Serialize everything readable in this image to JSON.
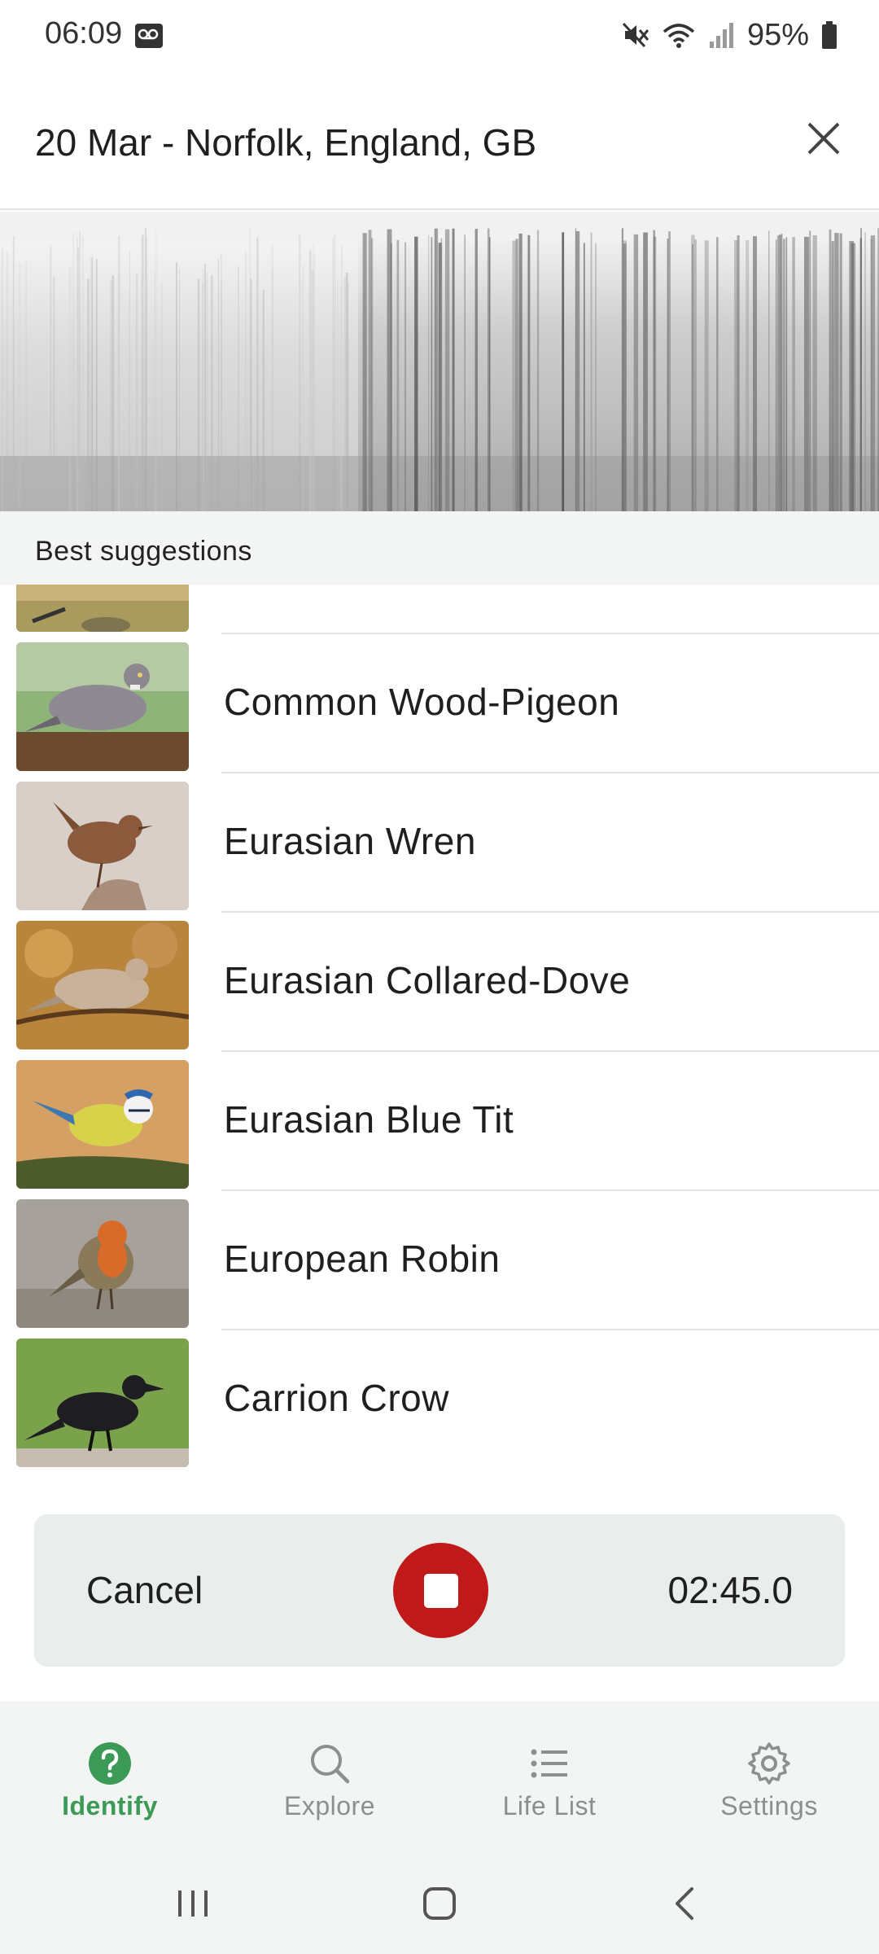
{
  "status_bar": {
    "time": "06:09",
    "battery": "95%"
  },
  "header": {
    "title": "20 Mar - Norfolk, England, GB",
    "close_icon": "close-icon"
  },
  "section": {
    "label": "Best suggestions"
  },
  "suggestions": [
    {
      "name": "",
      "image": "bird-thumbnail-partial"
    },
    {
      "name": "Common Wood-Pigeon",
      "image": "wood-pigeon-photo"
    },
    {
      "name": "Eurasian Wren",
      "image": "wren-photo"
    },
    {
      "name": "Eurasian Collared-Dove",
      "image": "collared-dove-photo"
    },
    {
      "name": "Eurasian Blue Tit",
      "image": "blue-tit-photo"
    },
    {
      "name": "European Robin",
      "image": "robin-photo"
    },
    {
      "name": "Carrion Crow",
      "image": "crow-photo"
    }
  ],
  "recording": {
    "cancel_label": "Cancel",
    "timer": "02:45.0",
    "stop_color": "#c0191a"
  },
  "nav": {
    "items": [
      {
        "label": "Identify",
        "icon": "help-circle-icon",
        "active": true
      },
      {
        "label": "Explore",
        "icon": "search-icon",
        "active": false
      },
      {
        "label": "Life List",
        "icon": "list-icon",
        "active": false
      },
      {
        "label": "Settings",
        "icon": "gear-icon",
        "active": false
      }
    ],
    "accent": "#3b9a55"
  }
}
